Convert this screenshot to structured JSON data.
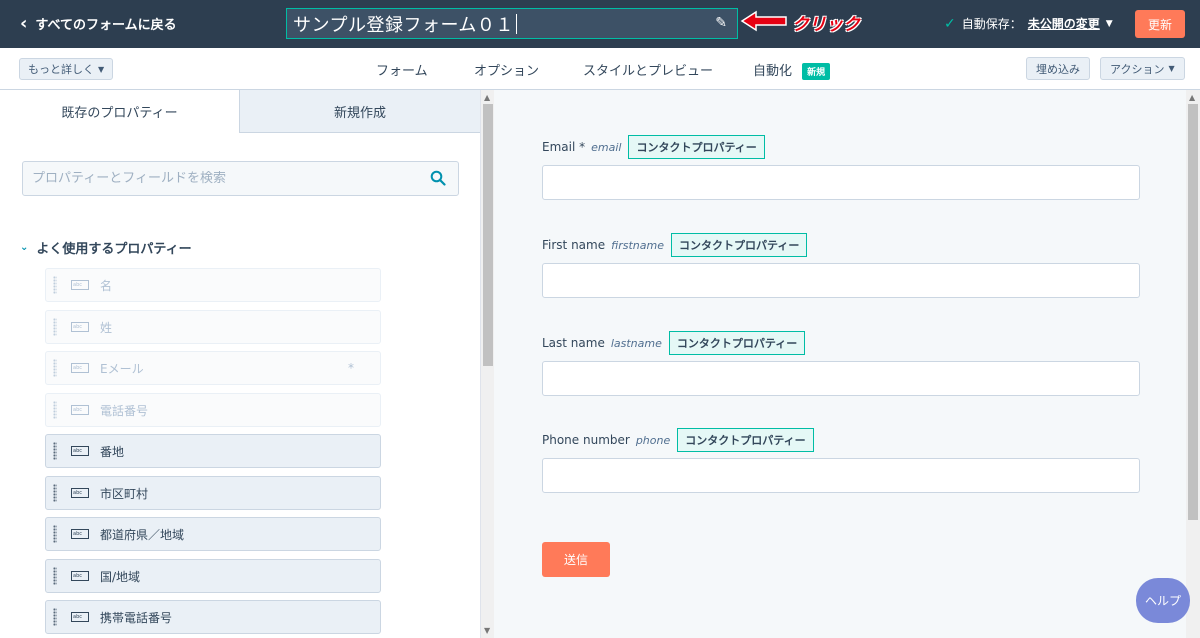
{
  "header": {
    "back_label": "すべてのフォームに戻る",
    "form_title": "サンプル登録フォーム０１",
    "annotation": "クリック",
    "autosave_label": "自動保存：",
    "autosave_status": "未公開の変更",
    "update_label": "更新"
  },
  "tabbar": {
    "more_label": "もっと詳しく",
    "tabs": [
      {
        "label": "フォーム",
        "active": true
      },
      {
        "label": "オプション"
      },
      {
        "label": "スタイルとプレビュー"
      },
      {
        "label": "自動化",
        "badge": "新規"
      }
    ],
    "embed_label": "埋め込み",
    "action_label": "アクション"
  },
  "left_panel": {
    "tabs": [
      "既存のプロパティー",
      "新規作成"
    ],
    "search_placeholder": "プロパティーとフィールドを検索",
    "section_title": "よく使用するプロパティー",
    "properties": [
      {
        "label": "名",
        "disabled": true
      },
      {
        "label": "姓",
        "disabled": true
      },
      {
        "label": "Eメール",
        "disabled": true,
        "required_mark": "*"
      },
      {
        "label": "電話番号",
        "disabled": true
      },
      {
        "label": "番地",
        "disabled": false
      },
      {
        "label": "市区町村",
        "disabled": false
      },
      {
        "label": "都道府県／地域",
        "disabled": false
      },
      {
        "label": "国/地域",
        "disabled": false
      },
      {
        "label": "携帯電話番号",
        "disabled": false
      }
    ],
    "field_icon_text": "abc"
  },
  "preview": {
    "fields": [
      {
        "label": "Email *",
        "internal": "email",
        "tag": "コンタクトプロパティー"
      },
      {
        "label": "First name",
        "internal": "firstname",
        "tag": "コンタクトプロパティー"
      },
      {
        "label": "Last name",
        "internal": "lastname",
        "tag": "コンタクトプロパティー"
      },
      {
        "label": "Phone number",
        "internal": "phone",
        "tag": "コンタクトプロパティー"
      }
    ],
    "submit_label": "送信"
  },
  "help_label": "ヘルプ",
  "colors": {
    "topbar": "#2d3e50",
    "accent_orange": "#ff7a59",
    "accent_teal": "#00bda5",
    "annotation_red": "#e60012",
    "help_blue": "#7a89d9"
  }
}
